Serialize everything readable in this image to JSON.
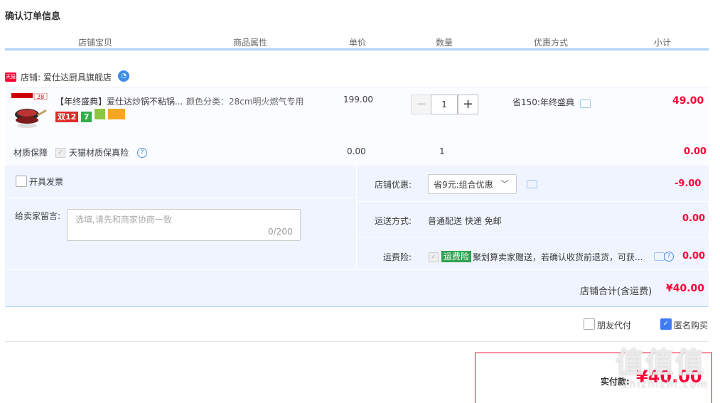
{
  "page": {
    "title": "确认订单信息"
  },
  "columns": [
    "店铺宝贝",
    "商品属性",
    "单价",
    "数量",
    "优惠方式",
    "小计"
  ],
  "shop": {
    "badge": "天猫",
    "name": "店铺: 爱仕达厨具旗舰店"
  },
  "item": {
    "title": "【年终盛典】爱仕达炒锅不粘锅...",
    "attr": "颜色分类：28cm明火燃气专用",
    "price": "199.00",
    "quantity": "1",
    "discount": "省150:年终盛典",
    "subtotal": "49.00",
    "tags": [
      "双12",
      "7",
      "",
      ""
    ],
    "thumb_banner": "28"
  },
  "service": {
    "label": "材质保障",
    "name": "天猫材质保真险",
    "price": "0.00",
    "qty": "1",
    "subtotal": "0.00"
  },
  "invoice": {
    "label": "开具发票"
  },
  "message": {
    "label": "给卖家留言:",
    "placeholder": "选填,请先和商家协商一致",
    "count": "0/200"
  },
  "shop_discount": {
    "label": "店铺优惠:",
    "selected": "省9元:组合优惠",
    "value": "-9.00"
  },
  "shipping": {
    "label": "运送方式:",
    "value": "普通配送 快递 免邮",
    "amount": "0.00"
  },
  "insurance": {
    "label": "运费险:",
    "badge": "运费险",
    "text": "聚划算卖家赠送，若确认收货前退货，可获...",
    "amount": "0.00"
  },
  "shop_total": {
    "label": "店铺合计(含运费)",
    "value": "¥40.00"
  },
  "options": {
    "friend_pay": "朋友代付",
    "anonymous": "匿名购买"
  },
  "payment": {
    "label": "实付款:",
    "value": "¥40.00"
  },
  "watermark": {
    "main": "值值值",
    "sub": "zhizhizhi.com"
  },
  "colors": {
    "accent": "#ff0036",
    "header_line": "#b2d1ff",
    "panel": "#eff4fe"
  }
}
